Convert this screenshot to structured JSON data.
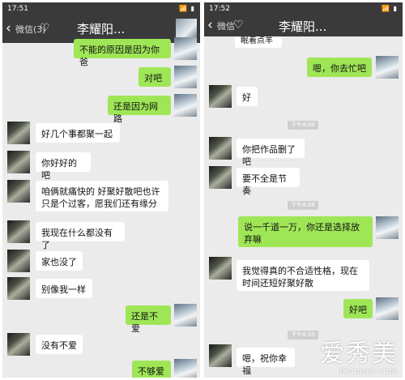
{
  "left": {
    "status_time": "17:51",
    "status_icons": "📶 ▮",
    "back_label": "微信(3)",
    "chat_title": "李耀阳...",
    "messages": [
      {
        "side": "sent",
        "text": "不能的原因是因为你爸"
      },
      {
        "side": "sent",
        "text": "对吧"
      },
      {
        "side": "sent",
        "text": "还是因为网路"
      },
      {
        "side": "recv",
        "text": "好几个事都聚一起"
      },
      {
        "side": "recv",
        "text": "你好好的吧"
      },
      {
        "side": "recv",
        "text": "咱俩就痛快的 好聚好散吧也许只是个过客，愿我们还有缘分"
      },
      {
        "side": "recv",
        "text": "我现在什么都没有了"
      },
      {
        "side": "recv",
        "text": "家也没了"
      },
      {
        "side": "recv",
        "text": "别像我一样"
      },
      {
        "side": "sent",
        "text": "还是不爱"
      },
      {
        "side": "recv",
        "text": "没有不爱"
      },
      {
        "side": "sent",
        "text": "不够爱"
      }
    ]
  },
  "right": {
    "status_time": "17:52",
    "status_icons": "📶 ▮",
    "back_label": "微信",
    "chat_title": "李耀阳...",
    "top_fragment": "眠着点羊",
    "messages": [
      {
        "side": "sent",
        "text": "嗯，你去忙吧"
      },
      {
        "side": "recv",
        "text": "好"
      },
      {
        "side": "time",
        "text": "下午4:00"
      },
      {
        "side": "recv",
        "text": "你把作品删了吧"
      },
      {
        "side": "recv",
        "text": "要不全是节奏"
      },
      {
        "side": "time",
        "text": "下午4:08"
      },
      {
        "side": "sent",
        "text": "说一千道一万，你还是选择放弃嘛"
      },
      {
        "side": "recv",
        "text": "我觉得真的不合适性格，现在时间还短好聚好散"
      },
      {
        "side": "sent",
        "text": "好吧"
      },
      {
        "side": "time",
        "text": "下午4:10"
      },
      {
        "side": "recv",
        "text": "嗯，祝你幸福"
      }
    ]
  },
  "watermark": {
    "big": "爱秀美",
    "small": "ixiumei.com"
  },
  "colors": {
    "sent_bubble": "#9fe657",
    "recv_bubble": "#ffffff",
    "chat_bg": "#ebebeb",
    "header": "#3a3a3a"
  }
}
